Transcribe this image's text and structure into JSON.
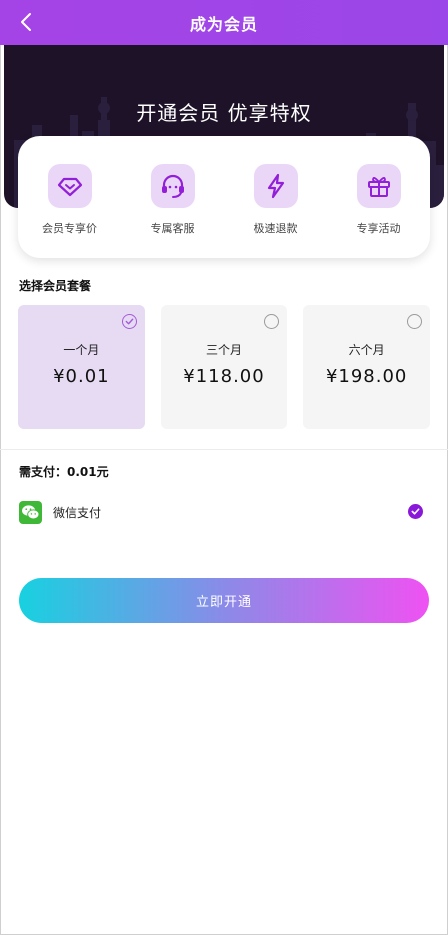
{
  "header": {
    "title": "成为会员"
  },
  "banner": {
    "title": "开通会员  优享特权"
  },
  "privileges": [
    {
      "label": "会员专享价",
      "icon": "diamond-icon"
    },
    {
      "label": "专属客服",
      "icon": "customer-service-icon"
    },
    {
      "label": "极速退款",
      "icon": "lightning-icon"
    },
    {
      "label": "专享活动",
      "icon": "gift-icon"
    }
  ],
  "plans_section": {
    "title": "选择会员套餐"
  },
  "plans": [
    {
      "name": "一个月",
      "price": "¥0.01",
      "selected": true
    },
    {
      "name": "三个月",
      "price": "¥118.00",
      "selected": false
    },
    {
      "name": "六个月",
      "price": "¥198.00",
      "selected": false
    }
  ],
  "payment": {
    "need_pay": "需支付：0.01元",
    "method": "微信支付",
    "method_icon": "wechat-icon",
    "selected": true
  },
  "cta": {
    "label": "立即开通"
  },
  "colors": {
    "header": "#a544e6",
    "accent": "#8a18d9",
    "icon_bg": "#ead7f7",
    "selected_plan_bg": "#e6dbf3",
    "wechat_green": "#3fb837",
    "cta_gradient": [
      "#18d1e0",
      "#8f88e8",
      "#ef52f2"
    ]
  }
}
